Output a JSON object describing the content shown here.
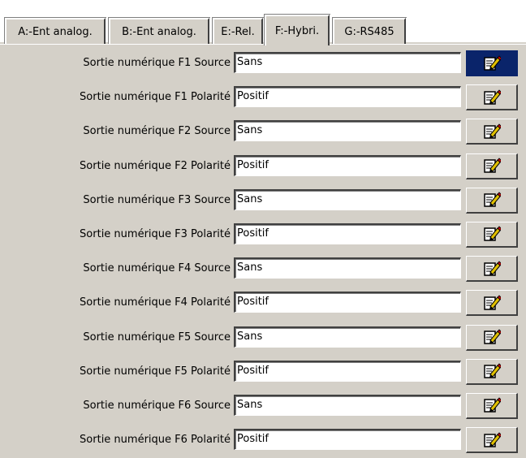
{
  "tabs": [
    {
      "label": "A:-Ent analog.",
      "active": false
    },
    {
      "label": "B:-Ent analog.",
      "active": false
    },
    {
      "label": "E:-Rel.",
      "active": false
    },
    {
      "label": "F:-Hybri.",
      "active": true
    },
    {
      "label": "G:-RS485",
      "active": false
    }
  ],
  "rows": [
    {
      "label": "Sortie numérique F1 Source",
      "value": "Sans",
      "button_icon": "edit-icon",
      "selected": true
    },
    {
      "label": "Sortie numérique F1 Polarité",
      "value": "Positif",
      "button_icon": "edit-icon",
      "selected": false
    },
    {
      "label": "Sortie numérique F2 Source",
      "value": "Sans",
      "button_icon": "edit-icon",
      "selected": false
    },
    {
      "label": "Sortie numérique F2 Polarité",
      "value": "Positif",
      "button_icon": "edit-icon",
      "selected": false
    },
    {
      "label": "Sortie numérique F3 Source",
      "value": "Sans",
      "button_icon": "edit-icon",
      "selected": false
    },
    {
      "label": "Sortie numérique F3 Polarité",
      "value": "Positif",
      "button_icon": "edit-icon",
      "selected": false
    },
    {
      "label": "Sortie numérique F4 Source",
      "value": "Sans",
      "button_icon": "edit-icon",
      "selected": false
    },
    {
      "label": "Sortie numérique F4 Polarité",
      "value": "Positif",
      "button_icon": "edit-icon",
      "selected": false
    },
    {
      "label": "Sortie numérique F5 Source",
      "value": "Sans",
      "button_icon": "edit-icon",
      "selected": false
    },
    {
      "label": "Sortie numérique F5 Polarité",
      "value": "Positif",
      "button_icon": "edit-icon",
      "selected": false
    },
    {
      "label": "Sortie numérique F6 Source",
      "value": "Sans",
      "button_icon": "edit-icon",
      "selected": false
    },
    {
      "label": "Sortie numérique F6 Polarité",
      "value": "Positif",
      "button_icon": "edit-icon",
      "selected": false
    }
  ],
  "colors": {
    "background": "#d4d0c8",
    "selected_button": "#0a246a",
    "field_background": "#ffffff"
  }
}
